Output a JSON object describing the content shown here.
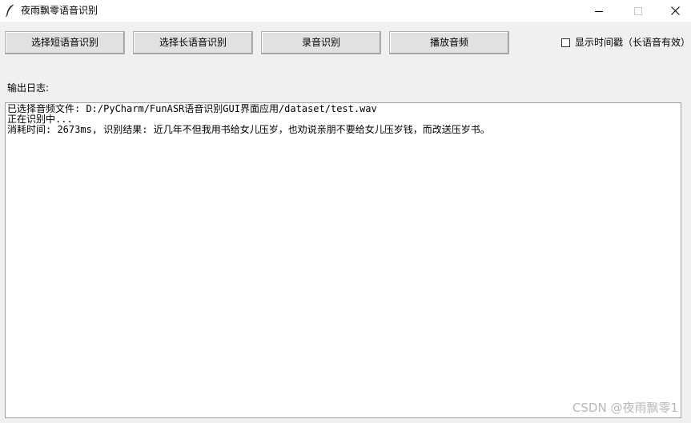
{
  "window": {
    "title": "夜雨飘零语音识别",
    "controls": {
      "minimize": "minimize-icon",
      "maximize": "maximize-icon",
      "close": "close-icon"
    }
  },
  "toolbar": {
    "short_audio_label": "选择短语音识别",
    "long_audio_label": "选择长语音识别",
    "record_label": "录音识别",
    "play_label": "播放音频"
  },
  "options": {
    "show_timestamp_label": "显示时间戳（长语音有效）",
    "show_timestamp_checked": false
  },
  "log": {
    "label": "输出日志:",
    "lines": [
      "已选择音频文件: D:/PyCharm/FunASR语音识别GUI界面应用/dataset/test.wav",
      "正在识别中...",
      "消耗时间: 2673ms, 识别结果: 近几年不但我用书给女儿压岁，也劝说亲朋不要给女儿压岁钱，而改送压岁书。"
    ]
  },
  "watermark": "CSDN @夜雨飘零1",
  "colors": {
    "window_bg": "#f0f0f0",
    "titlebar_bg": "#ffffff",
    "button_bg": "#e1e1e1",
    "button_border": "#adadad",
    "log_bg": "#ffffff",
    "watermark": "#b8b8b8"
  }
}
